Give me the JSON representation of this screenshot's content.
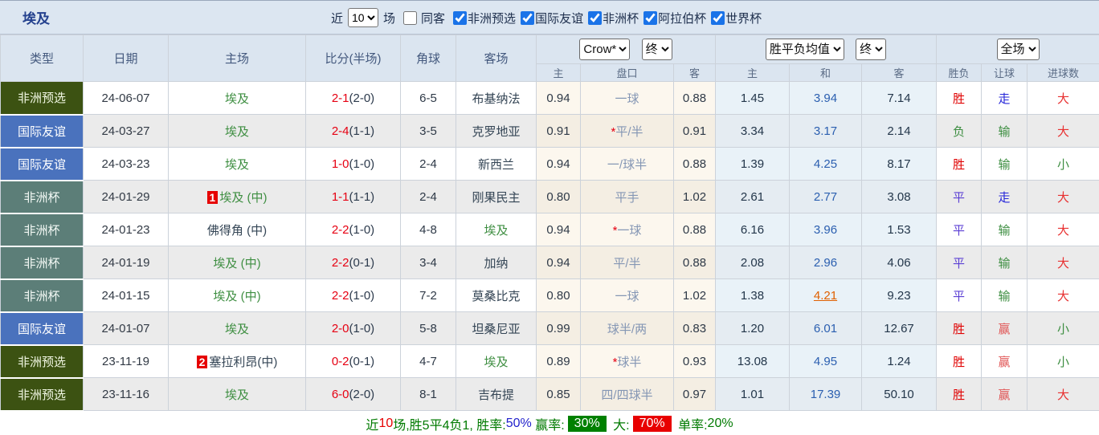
{
  "page": {
    "title": "埃及"
  },
  "controls": {
    "recent_label": "近",
    "recent_value": "10",
    "matches_label": "场",
    "same_away": {
      "label": "同客",
      "checked": false
    },
    "filters": [
      {
        "label": "非洲预选",
        "checked": true
      },
      {
        "label": "国际友谊",
        "checked": true
      },
      {
        "label": "非洲杯",
        "checked": true
      },
      {
        "label": "阿拉伯杯",
        "checked": true
      },
      {
        "label": "世界杯",
        "checked": true
      }
    ]
  },
  "selects": {
    "company": "Crow*",
    "company_period": "终",
    "odds_type": "胜平负均值",
    "odds_period": "终",
    "scope": "全场"
  },
  "columns": {
    "type": "类型",
    "date": "日期",
    "home": "主场",
    "score": "比分(半场)",
    "corner": "角球",
    "away": "客场",
    "hcap_home": "主",
    "hcap": "盘口",
    "hcap_away": "客",
    "odds_home": "主",
    "odds_draw": "和",
    "odds_away": "客",
    "result": "胜负",
    "hcap_result": "让球",
    "goals": "进球数"
  },
  "rows": [
    {
      "type": "非洲预选",
      "date": "24-06-07",
      "home": "埃及",
      "score": "2-1",
      "half": "(2-0)",
      "corner": "6-5",
      "away": "布基纳法",
      "hcap_home": "0.94",
      "handicap": "一球",
      "hcap_away": "0.88",
      "odds_home": "1.45",
      "odds_draw": "3.94",
      "odds_away": "7.14",
      "result": "胜",
      "hcap_result": "走",
      "goals": "大"
    },
    {
      "type": "国际友谊",
      "date": "24-03-27",
      "home": "埃及",
      "score": "2-4",
      "half": "(1-1)",
      "corner": "3-5",
      "away": "克罗地亚",
      "hcap_home": "0.91",
      "star": "*",
      "handicap": "平/半",
      "hcap_away": "0.91",
      "odds_home": "3.34",
      "odds_draw": "3.17",
      "odds_away": "2.14",
      "result": "负",
      "hcap_result": "输",
      "goals": "大"
    },
    {
      "type": "国际友谊",
      "date": "24-03-23",
      "home": "埃及",
      "score": "1-0",
      "half": "(1-0)",
      "corner": "2-4",
      "away": "新西兰",
      "hcap_home": "0.94",
      "handicap": "一/球半",
      "hcap_away": "0.88",
      "odds_home": "1.39",
      "odds_draw": "4.25",
      "odds_away": "8.17",
      "result": "胜",
      "hcap_result": "输",
      "goals": "小"
    },
    {
      "type": "非洲杯",
      "date": "24-01-29",
      "rank": "1",
      "home": "埃及 (中)",
      "score": "1-1",
      "half": "(1-1)",
      "corner": "2-4",
      "away": "刚果民主",
      "hcap_home": "0.80",
      "handicap": "平手",
      "hcap_away": "1.02",
      "odds_home": "2.61",
      "odds_draw": "2.77",
      "odds_away": "3.08",
      "result": "平",
      "hcap_result": "走",
      "goals": "大"
    },
    {
      "type": "非洲杯",
      "date": "24-01-23",
      "home": "佛得角 (中)",
      "score": "2-2",
      "half": "(1-0)",
      "corner": "4-8",
      "away": "埃及",
      "hcap_home": "0.94",
      "star": "*",
      "handicap": "一球",
      "hcap_away": "0.88",
      "odds_home": "6.16",
      "odds_draw": "3.96",
      "odds_away": "1.53",
      "result": "平",
      "hcap_result": "输",
      "goals": "大"
    },
    {
      "type": "非洲杯",
      "date": "24-01-19",
      "home": "埃及 (中)",
      "score": "2-2",
      "half": "(0-1)",
      "corner": "3-4",
      "away": "加纳",
      "hcap_home": "0.94",
      "handicap": "平/半",
      "hcap_away": "0.88",
      "odds_home": "2.08",
      "odds_draw": "2.96",
      "odds_away": "4.06",
      "result": "平",
      "hcap_result": "输",
      "goals": "大"
    },
    {
      "type": "非洲杯",
      "date": "24-01-15",
      "home": "埃及 (中)",
      "score": "2-2",
      "half": "(1-0)",
      "corner": "7-2",
      "away": "莫桑比克",
      "hcap_home": "0.80",
      "handicap": "一球",
      "hcap_away": "1.02",
      "odds_home": "1.38",
      "odds_draw": "4.21",
      "odds_away": "9.23",
      "result": "平",
      "hcap_result": "输",
      "goals": "大"
    },
    {
      "type": "国际友谊",
      "date": "24-01-07",
      "home": "埃及",
      "score": "2-0",
      "half": "(1-0)",
      "corner": "5-8",
      "away": "坦桑尼亚",
      "hcap_home": "0.99",
      "handicap": "球半/两",
      "hcap_away": "0.83",
      "odds_home": "1.20",
      "odds_draw": "6.01",
      "odds_away": "12.67",
      "result": "胜",
      "hcap_result": "赢",
      "goals": "小"
    },
    {
      "type": "非洲预选",
      "date": "23-11-19",
      "rank": "2",
      "home": "塞拉利昂(中)",
      "score": "0-2",
      "half": "(0-1)",
      "corner": "4-7",
      "away": "埃及",
      "hcap_home": "0.89",
      "star": "*",
      "handicap": "球半",
      "hcap_away": "0.93",
      "odds_home": "13.08",
      "odds_draw": "4.95",
      "odds_away": "1.24",
      "result": "胜",
      "hcap_result": "赢",
      "goals": "小"
    },
    {
      "type": "非洲预选",
      "date": "23-11-16",
      "home": "埃及",
      "score": "6-0",
      "half": "(2-0)",
      "corner": "8-1",
      "away": "吉布提",
      "hcap_home": "0.85",
      "handicap": "四/四球半",
      "hcap_away": "0.97",
      "odds_home": "1.01",
      "odds_draw": "17.39",
      "odds_away": "50.10",
      "result": "胜",
      "hcap_result": "赢",
      "goals": "大"
    }
  ],
  "footer": {
    "seg_recent": "近",
    "seg_count": "10",
    "seg_record": "场,胜5平4负1, ",
    "win_rate_label": "胜率:",
    "win_rate": "50%",
    "profit_rate_label": " 赢率:",
    "profit_rate": "30%",
    "big_label": " 大:",
    "big_rate": "70%",
    "single_label": " 单率:",
    "single_rate": "20%"
  },
  "colors": {
    "header_bg": "#dbe5f0",
    "title_text": "#24418e",
    "badge_africa_qual": "#3c5212",
    "badge_friendly": "#4a72bd",
    "badge_africa_cup": "#5c7e78",
    "score_red": "#e60012",
    "team_green": "#3e8e41",
    "handicap_text": "#8496b4",
    "odds_draw_blue": "#2b5fb0",
    "highlight_orange": "#e06000",
    "win_red": "#e00000",
    "draw_purple": "#5b3fd4",
    "lose_green": "#3d8e41",
    "walk_blue": "#2626d9",
    "stripe_gray": "#ebebeb",
    "cream_bg": "#fcf7ee",
    "blue_bg": "#e9f2f8",
    "footer_green": "#007a00",
    "footer_badge_green": "#008000",
    "footer_badge_red": "#e80000",
    "checkbox_blue": "#1a73e8"
  }
}
